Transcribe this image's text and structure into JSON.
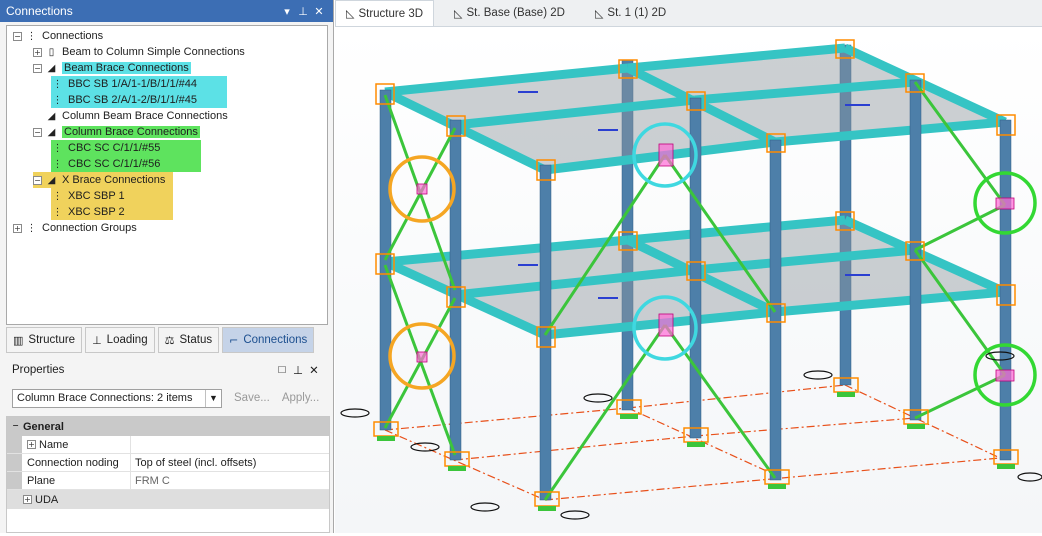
{
  "connections_panel": {
    "title": "Connections",
    "tree": {
      "root": "Connections",
      "beam_to_column": "Beam to Column Simple Connections",
      "beam_brace": {
        "label": "Beam Brace Connections",
        "items": [
          "BBC SB 1/A/1-1/B/1/1/#44",
          "BBC SB 2/A/1-2/B/1/1/#45"
        ],
        "highlight": "#5ce1e6"
      },
      "column_beam_brace": "Column Beam Brace Connections",
      "column_brace": {
        "label": "Column Brace Connections",
        "items": [
          "CBC SC C/1/1/#55",
          "CBC SC C/1/1/#56"
        ],
        "highlight": "#5ee35e"
      },
      "x_brace": {
        "label": "X Brace Connections",
        "items": [
          "XBC SBP 1",
          "XBC SBP 2"
        ],
        "highlight": "#f0d25c"
      },
      "groups": "Connection Groups"
    },
    "tabs": [
      {
        "label": "Structure",
        "icon": "structure-icon"
      },
      {
        "label": "Loading",
        "icon": "loading-icon"
      },
      {
        "label": "Status",
        "icon": "status-icon"
      },
      {
        "label": "Connections",
        "icon": "connections-icon",
        "active": true
      }
    ]
  },
  "properties_panel": {
    "title": "Properties",
    "selection": "Column Brace Connections: 2 items",
    "save_label": "Save...",
    "apply_label": "Apply...",
    "section": "General",
    "rows": [
      {
        "key": "Name",
        "value": ""
      },
      {
        "key": "Connection noding",
        "value": "Top of steel (incl. offsets)"
      },
      {
        "key": "Plane",
        "value": "FRM C"
      }
    ],
    "uda": "UDA"
  },
  "view_tabs": [
    {
      "label": "Structure 3D",
      "icon": "view-3d-icon",
      "active": true
    },
    {
      "label": "St. Base (Base) 2D",
      "icon": "view-2d-icon"
    },
    {
      "label": "St. 1 (1) 2D",
      "icon": "view-2d-icon"
    }
  ],
  "colors": {
    "panel_title": "#3c6eb4",
    "beam": "#35c4c4",
    "column": "#4d7fa9",
    "brace": "#3bc53b",
    "connection_box": "#ff8c00",
    "marker_orange": "#f5a623",
    "marker_cyan": "#3fd8e0",
    "marker_green": "#33d833",
    "grid_line": "#e8501a",
    "slab": "#8f979e"
  }
}
